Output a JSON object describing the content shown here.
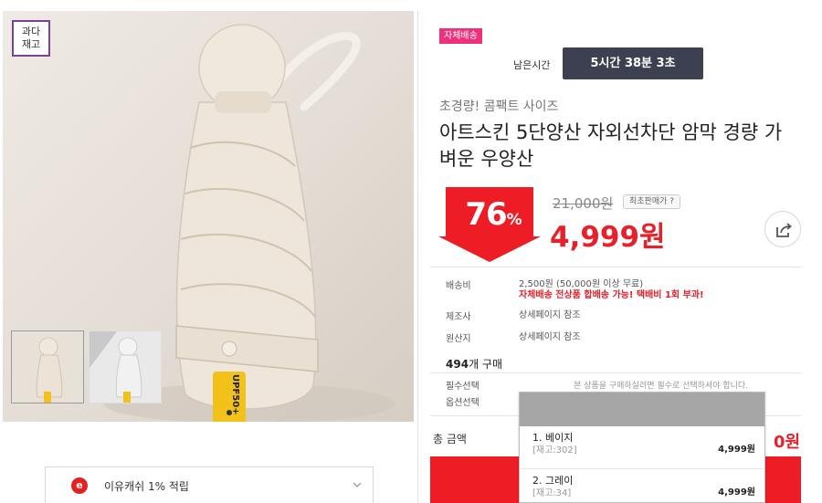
{
  "gallery": {
    "stock_badge": "과다\n재고",
    "stock_badge_line1": "과다",
    "stock_badge_line2": "재고",
    "label_text": "UPF50+",
    "thumbnails": [
      "beige",
      "gray"
    ],
    "thumbnail_selected": 0
  },
  "cashback": {
    "icon_letter": "e",
    "label": "이유캐쉬 1% 적립"
  },
  "deal": {
    "badge": "자체배송",
    "remaining_label": "남은시간",
    "timer": "5시간 38분 3초"
  },
  "product": {
    "subtitle": "초경량! 콤팩트 사이즈",
    "title": "아트스킨 5단양산 자외선차단 암막 경량 가벼운 우양산"
  },
  "price": {
    "discount_number": "76",
    "discount_unit": "%",
    "original": "21,000원",
    "lowest_button": "최초판매가 ?",
    "sale": "4,999원",
    "accent_color": "#e8202a"
  },
  "info": {
    "shipping_label": "배송비",
    "shipping_value": "2,500원 (50,000원 이상 무료)",
    "shipping_note": "자체배송 전상품 합배송 가능! 택배비 1회 부과!",
    "maker_label": "제조사",
    "maker_value": "상세페이지 참조",
    "origin_label": "원산지",
    "origin_value": "상세페이지 참조",
    "buy_count_number": "494",
    "buy_count_suffix": "개 구매",
    "required_label": "필수선택",
    "option_label": "옵션선택",
    "required_note": "본 상품을 구매하실려면 필수로 선택하셔야 합니다."
  },
  "total": {
    "label": "총 금액",
    "value": "0원"
  },
  "options": [
    {
      "name": "1. 베이지",
      "stock": "[재고:302]",
      "price": "4,999원"
    },
    {
      "name": "2. 그레이",
      "stock": "[재고:34]",
      "price": "4,999원"
    }
  ]
}
